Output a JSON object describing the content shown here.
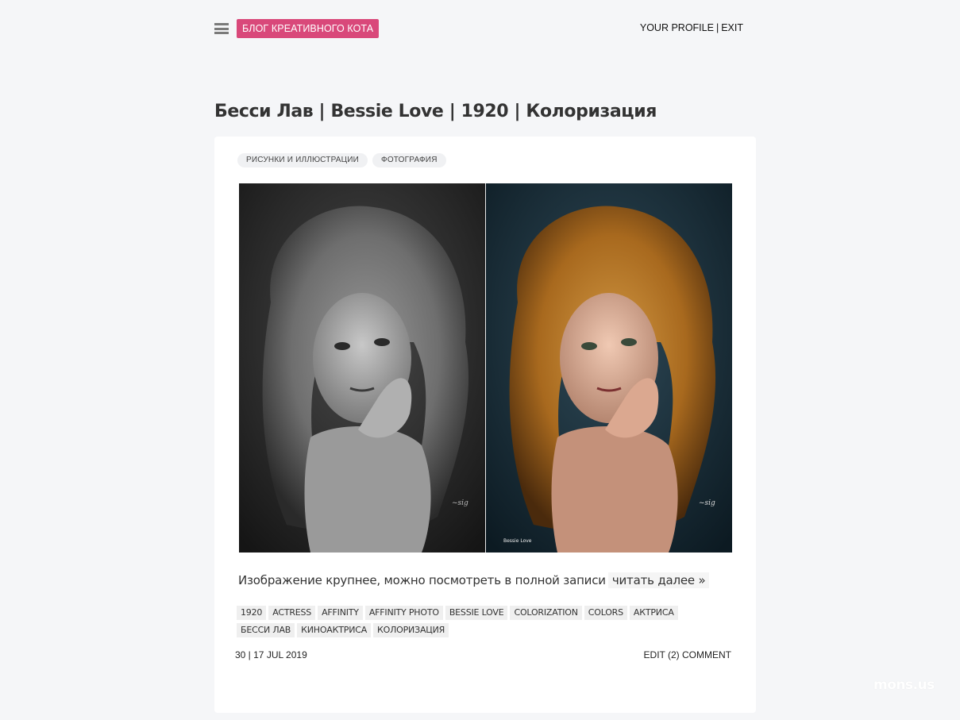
{
  "header": {
    "brand": "БЛОГ КРЕАТИВНОГО КОТА",
    "profile_link": "YOUR PROFILE",
    "separator": "|",
    "exit_link": "EXIT"
  },
  "post": {
    "title": "Бесси Лав | Bessie Love | 1920 | Колоризация",
    "categories": [
      "РИСУНКИ И ИЛЛЮСТРАЦИИ",
      "ФОТОГРАФИЯ"
    ],
    "excerpt": "Изображение крупнее, можно посмотреть в полной записи",
    "read_more": "читать далее »",
    "tags": [
      "1920",
      "ACTRESS",
      "AFFINITY",
      "AFFINITY PHOTO",
      "BESSIE LOVE",
      "COLORIZATION",
      "COLORS",
      "АКТРИСА",
      "БЕССИ ЛАВ",
      "КИНОАКТРИСА",
      "КОЛОРИЗАЦИЯ"
    ],
    "meta_left": "30 | 17 JUL 2019",
    "edit_link": "EDIT",
    "comment_link": "(2) COMMENT",
    "photo_caption": "Bessie Love"
  },
  "watermark": "mons.us"
}
